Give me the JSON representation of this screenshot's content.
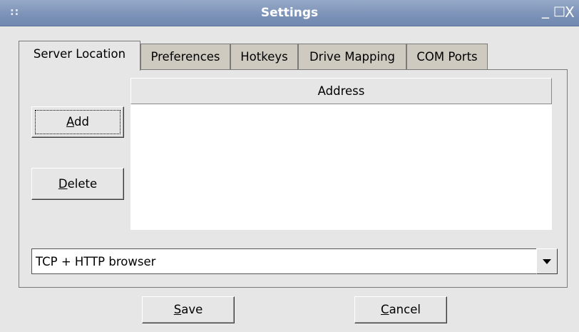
{
  "window": {
    "title": "Settings",
    "grip": "::",
    "minimize": "_",
    "maximize": "□",
    "close": "X"
  },
  "tabs": [
    {
      "label": "Server Location",
      "active": true
    },
    {
      "label": "Preferences",
      "active": false
    },
    {
      "label": "Hotkeys",
      "active": false
    },
    {
      "label": "Drive Mapping",
      "active": false
    },
    {
      "label": "COM Ports",
      "active": false
    }
  ],
  "list": {
    "column_header": "Address",
    "rows": []
  },
  "buttons": {
    "add": {
      "mnemonic": "A",
      "rest": "dd"
    },
    "delete": {
      "mnemonic": "D",
      "rest": "elete"
    },
    "save": {
      "mnemonic": "S",
      "rest": "ave"
    },
    "cancel": {
      "mnemonic": "C",
      "rest": "ancel"
    }
  },
  "combo": {
    "selected": "TCP + HTTP browser"
  }
}
